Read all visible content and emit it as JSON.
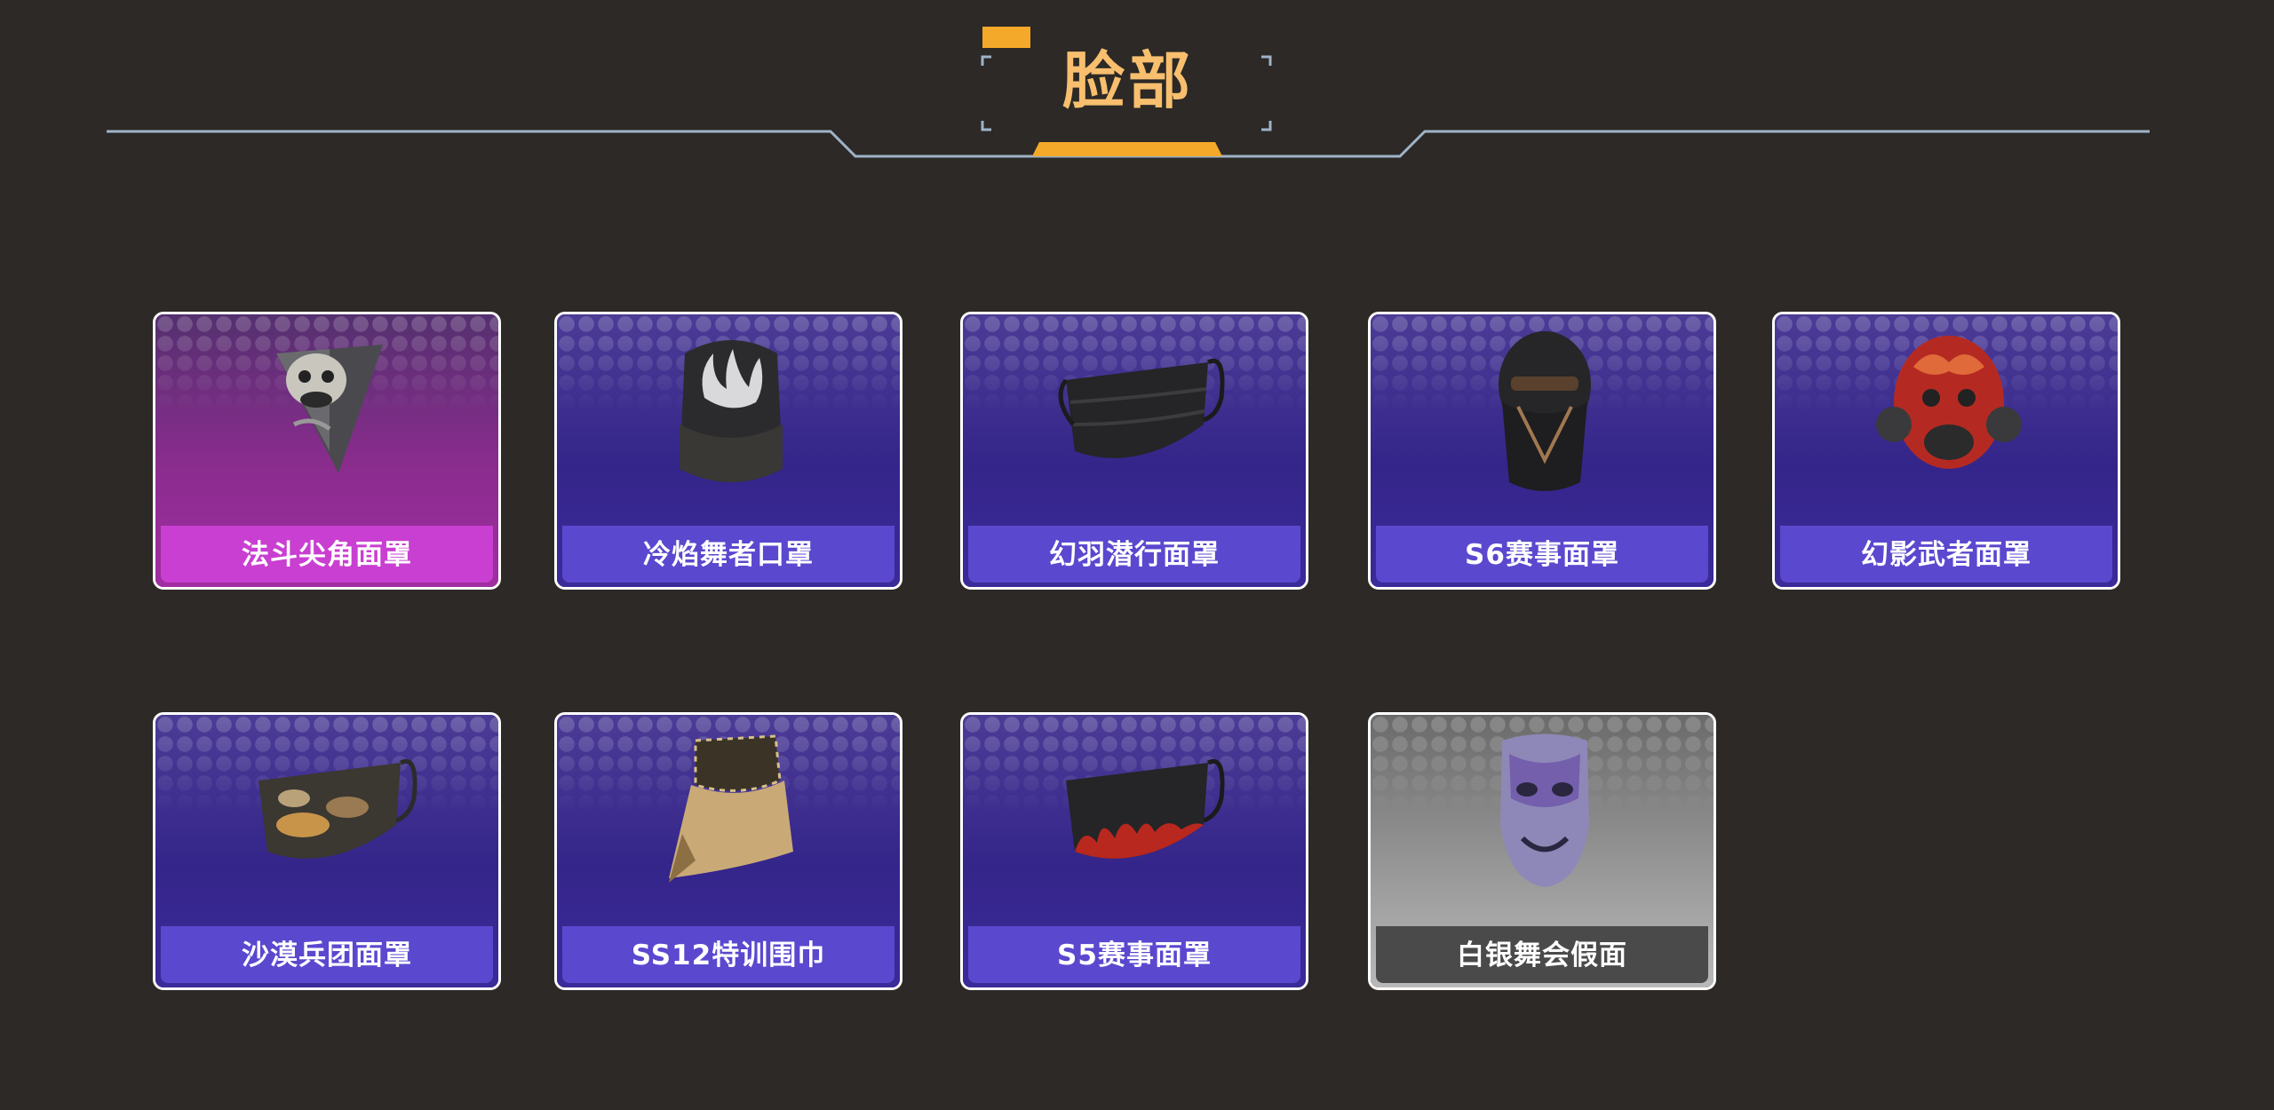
{
  "header": {
    "title": "脸部"
  },
  "colors": {
    "background": "#2c2926",
    "title": "#f7bf6e",
    "accent": "#f4a92a",
    "header_line": "#9fb3c8",
    "card_purple": "#5a48cf",
    "card_pink": "#c93fd1",
    "card_gray": "#4a4a4a"
  },
  "items": [
    {
      "name": "法斗尖角面罩",
      "theme": "pink",
      "icon": "bulldog-bandana-mask-icon"
    },
    {
      "name": "冷焰舞者口罩",
      "theme": "purple",
      "icon": "flame-neck-gaiter-icon"
    },
    {
      "name": "幻羽潜行面罩",
      "theme": "purple",
      "icon": "black-face-mask-icon"
    },
    {
      "name": "S6赛事面罩",
      "theme": "purple",
      "icon": "ninja-hood-mask-icon"
    },
    {
      "name": "幻影武者面罩",
      "theme": "purple",
      "icon": "red-samurai-gas-mask-icon"
    },
    {
      "name": "沙漠兵团面罩",
      "theme": "purple",
      "icon": "desert-camo-mask-icon"
    },
    {
      "name": "SS12特训围巾",
      "theme": "purple",
      "icon": "shemagh-scarf-icon"
    },
    {
      "name": "S5赛事面罩",
      "theme": "purple",
      "icon": "flame-face-mask-icon"
    },
    {
      "name": "白银舞会假面",
      "theme": "gray",
      "icon": "silver-masquerade-mask-icon"
    }
  ]
}
